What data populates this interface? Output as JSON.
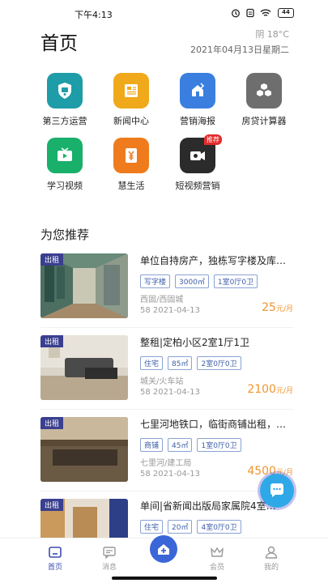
{
  "status": {
    "time": "下午4:13",
    "battery": "44"
  },
  "header": {
    "title": "首页",
    "weather": "阴 18°C",
    "date": "2021年04月13日星期二"
  },
  "grid": [
    {
      "label": "第三方运营",
      "icon": "police-badge-icon",
      "color": "#1e9ca8"
    },
    {
      "label": "新闻中心",
      "icon": "newspaper-icon",
      "color": "#f0a91b"
    },
    {
      "label": "营销海报",
      "icon": "house-share-icon",
      "color": "#3a7fe0"
    },
    {
      "label": "房贷计算器",
      "icon": "cubes-icon",
      "color": "#6e6e6e"
    },
    {
      "label": "学习视频",
      "icon": "tv-icon",
      "color": "#18b06a"
    },
    {
      "label": "慧生活",
      "icon": "yen-icon",
      "color": "#ef7b1c"
    },
    {
      "label": "短视频营销",
      "icon": "video-camera-icon",
      "color": "#2b2b2b",
      "badge": "推荐"
    }
  ],
  "section": {
    "title": "为您推荐"
  },
  "listings": [
    {
      "tag": "出租",
      "title": "单位自持房产，独栋写字楼及库…",
      "chips": [
        "写字楼",
        "3000㎡",
        "1室0厅0卫"
      ],
      "area": "西固/西固城",
      "date": "58 2021-04-13",
      "price": "25",
      "unit": "元/月"
    },
    {
      "tag": "出租",
      "title": "整租|定柏小区2室1厅1卫",
      "chips": [
        "住宅",
        "85㎡",
        "2室0厅0卫"
      ],
      "area": "城关/火车站",
      "date": "58 2021-04-13",
      "price": "2100",
      "unit": "元/月"
    },
    {
      "tag": "出租",
      "title": "七里河地铁口，临街商铺出租，…",
      "chips": [
        "商铺",
        "45㎡",
        "1室0厅0卫"
      ],
      "area": "七里河/建工局",
      "date": "58 2021-04-13",
      "price": "4500",
      "unit": "元/月"
    },
    {
      "tag": "出租",
      "title": "单间|省新闻出版局家属院4室…",
      "chips": [
        "住宅",
        "20㎡",
        "4室0厅0卫"
      ],
      "area": "",
      "date": "",
      "price": "",
      "unit": ""
    }
  ],
  "tabbar": {
    "home": "首页",
    "messages": "消息",
    "member": "会员",
    "mine": "我的"
  }
}
